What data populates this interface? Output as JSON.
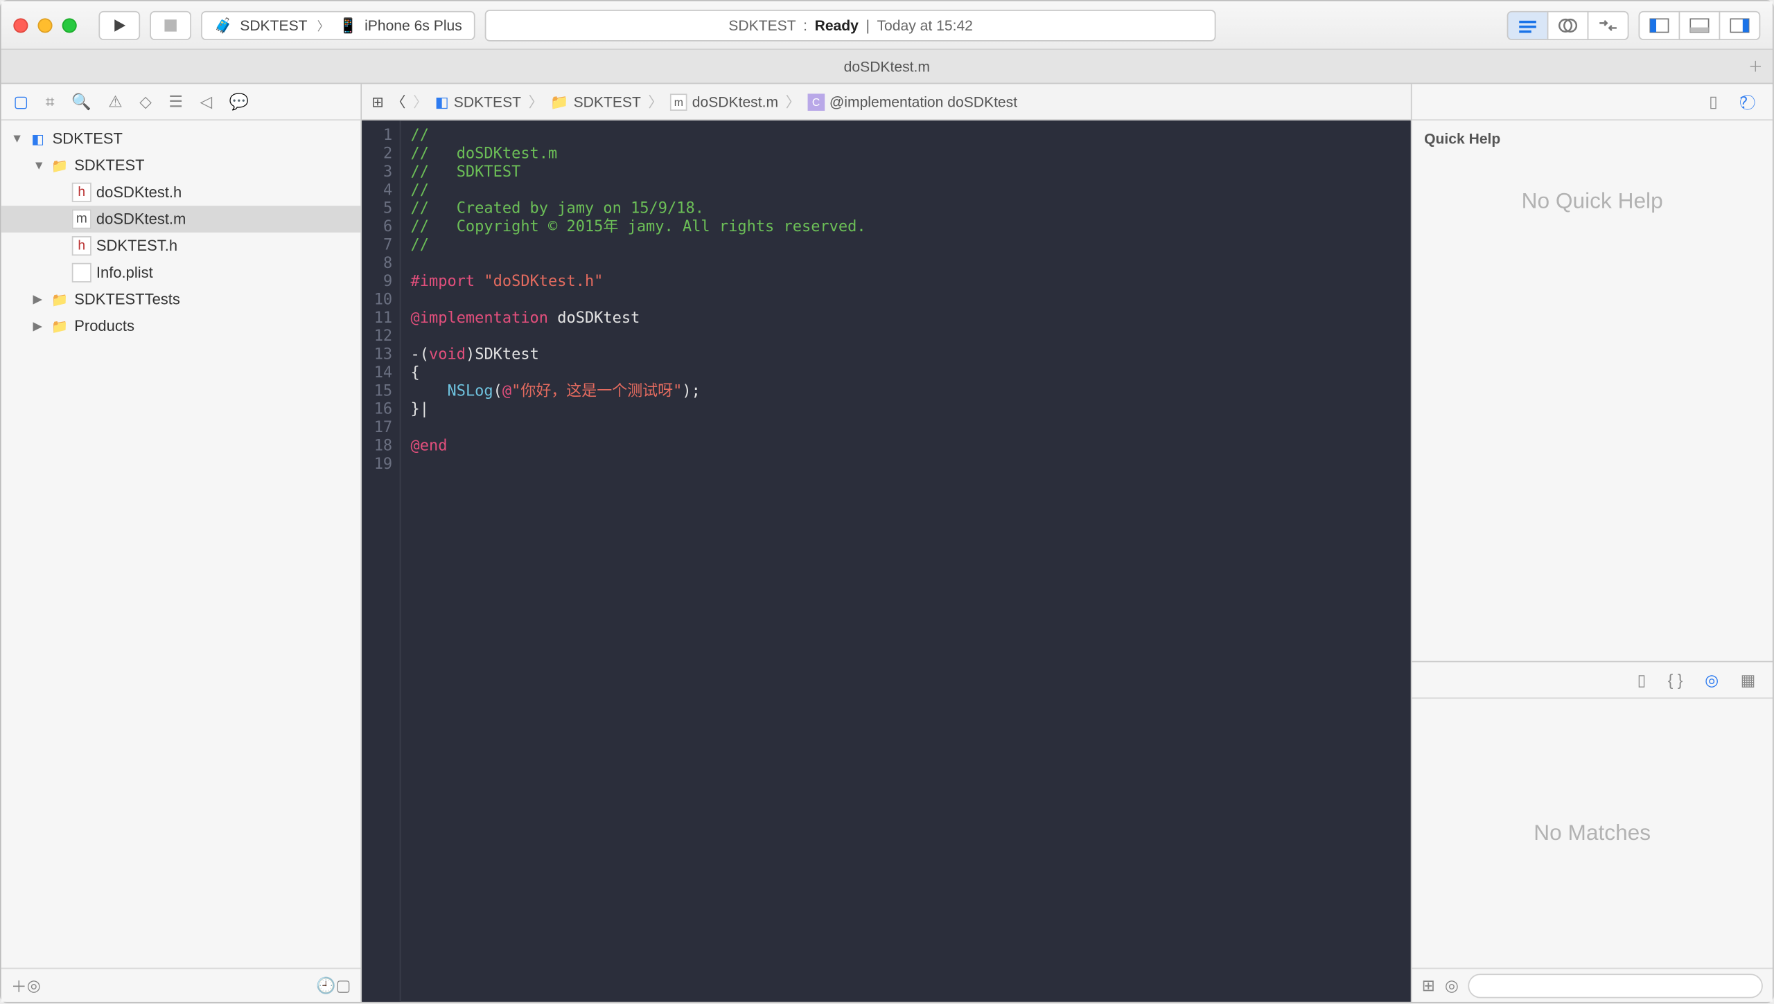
{
  "toolbar": {
    "scheme_target": "SDKTEST",
    "scheme_device": "iPhone 6s Plus",
    "status_project": "SDKTEST",
    "status_state": "Ready",
    "status_time": "Today at 15:42"
  },
  "tab": {
    "title": "doSDKtest.m"
  },
  "navigator": {
    "project": "SDKTEST",
    "items": [
      {
        "indent": 1,
        "kind": "folder",
        "label": "SDKTEST",
        "expanded": true
      },
      {
        "indent": 2,
        "kind": "h",
        "label": "doSDKtest.h"
      },
      {
        "indent": 2,
        "kind": "m",
        "label": "doSDKtest.m",
        "selected": true
      },
      {
        "indent": 2,
        "kind": "h",
        "label": "SDKTEST.h"
      },
      {
        "indent": 2,
        "kind": "plist",
        "label": "Info.plist"
      },
      {
        "indent": 1,
        "kind": "folder",
        "label": "SDKTESTTests",
        "expanded": false
      },
      {
        "indent": 1,
        "kind": "folder",
        "label": "Products",
        "expanded": false
      }
    ]
  },
  "jumpbar": {
    "crumbs": [
      "SDKTEST",
      "SDKTEST",
      "doSDKtest.m",
      "@implementation doSDKtest"
    ]
  },
  "code": {
    "lines": [
      {
        "n": 1,
        "tokens": [
          [
            "comment",
            "//"
          ]
        ]
      },
      {
        "n": 2,
        "tokens": [
          [
            "comment",
            "//   doSDKtest.m"
          ]
        ]
      },
      {
        "n": 3,
        "tokens": [
          [
            "comment",
            "//   SDKTEST"
          ]
        ]
      },
      {
        "n": 4,
        "tokens": [
          [
            "comment",
            "//"
          ]
        ]
      },
      {
        "n": 5,
        "tokens": [
          [
            "comment",
            "//   Created by jamy on 15/9/18."
          ]
        ]
      },
      {
        "n": 6,
        "tokens": [
          [
            "comment",
            "//   Copyright © 2015年 jamy. All rights reserved."
          ]
        ]
      },
      {
        "n": 7,
        "tokens": [
          [
            "comment",
            "//"
          ]
        ]
      },
      {
        "n": 8,
        "tokens": [
          [
            "plain",
            ""
          ]
        ]
      },
      {
        "n": 9,
        "tokens": [
          [
            "pre",
            "#import "
          ],
          [
            "string",
            "\"doSDKtest.h\""
          ]
        ]
      },
      {
        "n": 10,
        "tokens": [
          [
            "plain",
            ""
          ]
        ]
      },
      {
        "n": 11,
        "tokens": [
          [
            "kw",
            "@implementation"
          ],
          [
            "plain",
            " "
          ],
          [
            "id",
            "doSDKtest"
          ]
        ]
      },
      {
        "n": 12,
        "tokens": [
          [
            "plain",
            ""
          ]
        ]
      },
      {
        "n": 13,
        "tokens": [
          [
            "plain",
            "-("
          ],
          [
            "type",
            "void"
          ],
          [
            "plain",
            ")"
          ],
          [
            "id",
            "SDKtest"
          ]
        ]
      },
      {
        "n": 14,
        "tokens": [
          [
            "plain",
            "{"
          ]
        ]
      },
      {
        "n": 15,
        "tokens": [
          [
            "plain",
            "    "
          ],
          [
            "func",
            "NSLog"
          ],
          [
            "plain",
            "("
          ],
          [
            "kw",
            "@"
          ],
          [
            "string",
            "\"你好，这是一个测试呀\""
          ],
          [
            "plain",
            ");"
          ]
        ]
      },
      {
        "n": 16,
        "tokens": [
          [
            "plain",
            "}|"
          ]
        ]
      },
      {
        "n": 17,
        "tokens": [
          [
            "plain",
            ""
          ]
        ]
      },
      {
        "n": 18,
        "tokens": [
          [
            "kw",
            "@end"
          ]
        ]
      },
      {
        "n": 19,
        "tokens": [
          [
            "plain",
            ""
          ]
        ]
      }
    ]
  },
  "inspector": {
    "quick_help_title": "Quick Help",
    "quick_help_body": "No Quick Help",
    "library_body": "No Matches"
  }
}
